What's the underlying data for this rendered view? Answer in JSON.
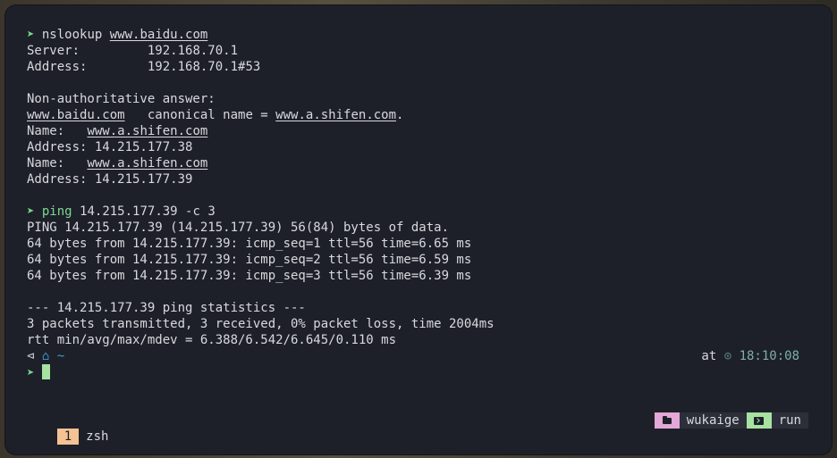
{
  "terminal": {
    "block1": {
      "cmd": "nslookup",
      "arg": "www.baidu.com",
      "server_label": "Server:",
      "server_value": "192.168.70.1",
      "address_label": "Address:",
      "address_value": "192.168.70.1#53",
      "non_auth": "Non-authoritative answer:",
      "alias_host": "www.baidu.com",
      "canonical_text": "canonical name =",
      "canonical_host": "www.a.shifen.com",
      "name_label": "Name:",
      "name1": "www.a.shifen.com",
      "addr1": "Address: 14.215.177.38",
      "name2": "www.a.shifen.com",
      "addr2": "Address: 14.215.177.39"
    },
    "block2": {
      "cmd": "ping",
      "arg": "14.215.177.39 -c 3",
      "header": "PING 14.215.177.39 (14.215.177.39) 56(84) bytes of data.",
      "reply1": "64 bytes from 14.215.177.39: icmp_seq=1 ttl=56 time=6.65 ms",
      "reply2": "64 bytes from 14.215.177.39: icmp_seq=2 ttl=56 time=6.59 ms",
      "reply3": "64 bytes from 14.215.177.39: icmp_seq=3 ttl=56 time=6.39 ms",
      "stats_header": "--- 14.215.177.39 ping statistics ---",
      "stats_line": "3 packets transmitted, 3 received, 0% packet loss, time 2004ms",
      "rtt_line": "rtt min/avg/max/mdev = 6.388/6.542/6.645/0.110 ms"
    },
    "prompt": {
      "symbol": "➤",
      "dir_arrow": "⊲",
      "home_icon": "⌂",
      "cwd": "~",
      "right_at": "at",
      "clock_icon": "⊙",
      "time": "18:10:08"
    }
  },
  "statusbar": {
    "window_index": "1",
    "window_name": "zsh",
    "session_user": "wukaige",
    "run_label": "run"
  },
  "colors": {
    "background": "#1e2029",
    "prompt_green": "#7bd88f",
    "home_blue": "#3f9bd7",
    "index_orange": "#f5c294",
    "session_pink": "#e3a7d8",
    "run_green": "#a6e3a1"
  }
}
